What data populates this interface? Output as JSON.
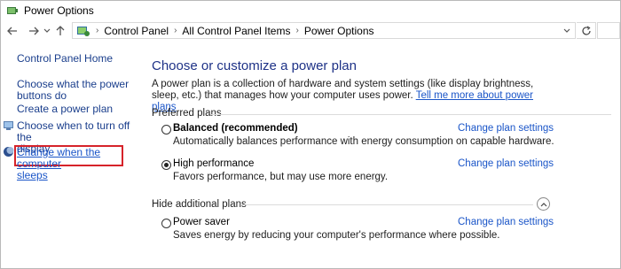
{
  "window": {
    "title": "Power Options"
  },
  "nav": {
    "back_icon": "arrow-left-icon",
    "forward_icon": "arrow-right-icon",
    "recent_icon": "chevron-down-icon",
    "up_icon": "arrow-up-icon",
    "refresh_icon": "refresh-icon"
  },
  "address": {
    "crumbs": [
      "Control Panel",
      "All Control Panel Items",
      "Power Options"
    ]
  },
  "sidebar": {
    "home": "Control Panel Home",
    "links": [
      {
        "label": "Choose what the power buttons do",
        "lines": [
          "Choose what the power",
          "buttons do"
        ]
      },
      {
        "label": "Create a power plan",
        "lines": [
          "Create a power plan"
        ]
      },
      {
        "label": "Choose when to turn off the display",
        "lines": [
          "Choose when to turn off the",
          "display"
        ]
      },
      {
        "label": "Change when the computer sleeps",
        "lines": [
          "Change when the computer",
          "sleeps"
        ]
      }
    ]
  },
  "main": {
    "heading": "Choose or customize a power plan",
    "description": "A power plan is a collection of hardware and system settings (like display brightness, sleep, etc.) that manages how your computer uses power.",
    "description_link": "Tell me more about power plans",
    "preferred_label": "Preferred plans",
    "hidden_label": "Hide additional plans",
    "change_label": "Change plan settings",
    "plans": [
      {
        "name": "Balanced (recommended)",
        "desc": "Automatically balances performance with energy consumption on capable hardware.",
        "selected": false
      },
      {
        "name": "High performance",
        "desc": "Favors performance, but may use more energy.",
        "selected": true
      },
      {
        "name": "Power saver",
        "desc": "Saves energy by reducing your computer's performance where possible.",
        "selected": false
      }
    ]
  },
  "colors": {
    "link": "#1a55c8",
    "heading": "#1e3287",
    "highlight": "#d6232a"
  }
}
